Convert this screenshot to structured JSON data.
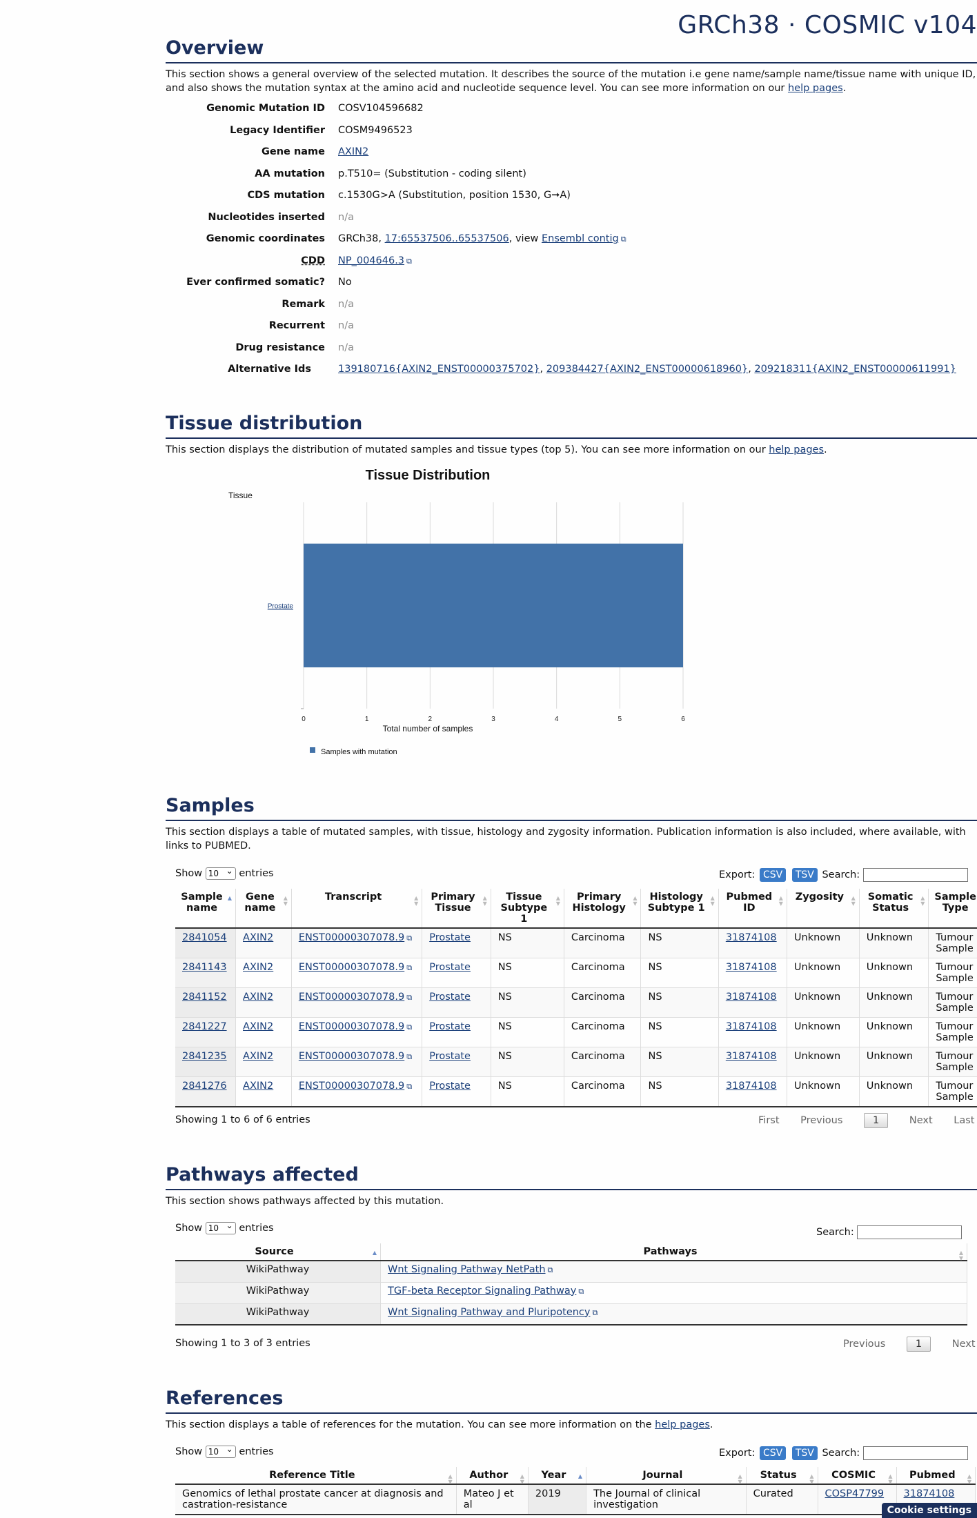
{
  "header": {
    "build_title": "GRCh38 · COSMIC v104"
  },
  "overview": {
    "heading": "Overview",
    "intro_text": "This section shows a general overview of the selected mutation. It describes the source of the mutation i.e gene name/sample name/tissue name with unique ID, and also shows the mutation syntax at the amino acid and nucleotide sequence level. You can see more information on our",
    "help_link": "help pages",
    "fields": {
      "genomic_mutation_id": {
        "label": "Genomic Mutation ID",
        "value": "COSV104596682"
      },
      "legacy_identifier": {
        "label": "Legacy Identifier",
        "value": "COSM9496523"
      },
      "gene_name": {
        "label": "Gene name",
        "value": "AXIN2"
      },
      "aa_mutation": {
        "label": "AA mutation",
        "value": "p.T510= (Substitution - coding silent)"
      },
      "cds_mutation": {
        "label": "CDS mutation",
        "value": "c.1530G>A (Substitution, position 1530, G➞A)"
      },
      "nucleotides_inserted": {
        "label": "Nucleotides inserted",
        "value": "n/a"
      },
      "genomic_coordinates": {
        "label": "Genomic coordinates",
        "prefix": "GRCh38,",
        "coord_link": "17:65537506..65537506",
        "view_text": ", view",
        "ensembl_link": "Ensembl contig"
      },
      "cdd": {
        "label": "CDD",
        "value": "NP_004646.3"
      },
      "ever_confirmed_somatic": {
        "label": "Ever confirmed somatic?",
        "value": "No"
      },
      "remark": {
        "label": "Remark",
        "value": "n/a"
      },
      "recurrent": {
        "label": "Recurrent",
        "value": "n/a"
      },
      "drug_resistance": {
        "label": "Drug resistance",
        "value": "n/a"
      },
      "alternative_ids": {
        "label": "Alternative Ids",
        "ids": [
          "139180716{AXIN2_ENST00000375702}",
          "209384427{AXIN2_ENST00000618960}",
          "209218311{AXIN2_ENST00000611991}"
        ]
      }
    }
  },
  "tissue_distribution": {
    "heading": "Tissue distribution",
    "intro_text": "This section displays the distribution of mutated samples and tissue types (top 5). You can see more information on our",
    "help_link": "help pages"
  },
  "chart_data": {
    "type": "bar",
    "orientation": "horizontal",
    "title": "Tissue Distribution",
    "ylabel": "Tissue",
    "xlabel": "Total number of samples",
    "categories": [
      "Prostate"
    ],
    "series": [
      {
        "name": "Samples with mutation",
        "values": [
          6
        ],
        "color": "#4272a8"
      }
    ],
    "xlim": [
      0,
      6
    ],
    "xticks": [
      "0",
      "1",
      "2",
      "3",
      "4",
      "5",
      "6"
    ],
    "grid": true,
    "legend": "bottom-left"
  },
  "samples": {
    "heading": "Samples",
    "intro_text": "This section displays a table of mutated samples, with tissue, histology and zygosity information. Publication information is also included, where available, with links to PUBMED.",
    "show_label": "Show",
    "page_size": "10",
    "entries_label": "entries",
    "export_label": "Export:",
    "csv": "CSV",
    "tsv": "TSV",
    "search_label": "Search:",
    "columns": [
      "Sample name",
      "Gene name",
      "Transcript",
      "Primary Tissue",
      "Tissue Subtype 1",
      "Primary Histology",
      "Histology Subtype 1",
      "Pubmed ID",
      "Zygosity",
      "Somatic Status",
      "Sample Type"
    ],
    "rows": [
      [
        "2841054",
        "AXIN2",
        "ENST00000307078.9",
        "Prostate",
        "NS",
        "Carcinoma",
        "NS",
        "31874108",
        "Unknown",
        "Unknown",
        "Tumour Sample"
      ],
      [
        "2841143",
        "AXIN2",
        "ENST00000307078.9",
        "Prostate",
        "NS",
        "Carcinoma",
        "NS",
        "31874108",
        "Unknown",
        "Unknown",
        "Tumour Sample"
      ],
      [
        "2841152",
        "AXIN2",
        "ENST00000307078.9",
        "Prostate",
        "NS",
        "Carcinoma",
        "NS",
        "31874108",
        "Unknown",
        "Unknown",
        "Tumour Sample"
      ],
      [
        "2841227",
        "AXIN2",
        "ENST00000307078.9",
        "Prostate",
        "NS",
        "Carcinoma",
        "NS",
        "31874108",
        "Unknown",
        "Unknown",
        "Tumour Sample"
      ],
      [
        "2841235",
        "AXIN2",
        "ENST00000307078.9",
        "Prostate",
        "NS",
        "Carcinoma",
        "NS",
        "31874108",
        "Unknown",
        "Unknown",
        "Tumour Sample"
      ],
      [
        "2841276",
        "AXIN2",
        "ENST00000307078.9",
        "Prostate",
        "NS",
        "Carcinoma",
        "NS",
        "31874108",
        "Unknown",
        "Unknown",
        "Tumour Sample"
      ]
    ],
    "info": "Showing 1 to 6 of 6 entries",
    "pager": {
      "first": "First",
      "previous": "Previous",
      "current": "1",
      "next": "Next",
      "last": "Last"
    }
  },
  "pathways": {
    "heading": "Pathways affected",
    "intro_text": "This section shows pathways affected by this mutation.",
    "show_label": "Show",
    "page_size": "10",
    "entries_label": "entries",
    "search_label": "Search:",
    "columns": [
      "Source",
      "Pathways"
    ],
    "rows": [
      [
        "WikiPathway",
        "Wnt Signaling Pathway NetPath"
      ],
      [
        "WikiPathway",
        "TGF-beta Receptor Signaling Pathway"
      ],
      [
        "WikiPathway",
        "Wnt Signaling Pathway and Pluripotency"
      ]
    ],
    "info": "Showing 1 to 3 of 3 entries",
    "pager": {
      "previous": "Previous",
      "current": "1",
      "next": "Next"
    }
  },
  "references": {
    "heading": "References",
    "intro_text": "This section displays a table of references for the mutation. You can see more information on the",
    "help_link": "help pages",
    "show_label": "Show",
    "page_size": "10",
    "entries_label": "entries",
    "export_label": "Export:",
    "csv": "CSV",
    "tsv": "TSV",
    "search_label": "Search:",
    "columns": [
      "Reference Title",
      "Author",
      "Year",
      "Journal",
      "Status",
      "COSMIC",
      "Pubmed"
    ],
    "rows": [
      [
        "Genomics of lethal prostate cancer at diagnosis and castration-resistance",
        "Mateo J et al",
        "2019",
        "The Journal of clinical investigation",
        "Curated",
        "COSP47799",
        "31874108"
      ]
    ]
  },
  "cookie": {
    "label": "Cookie settings"
  }
}
